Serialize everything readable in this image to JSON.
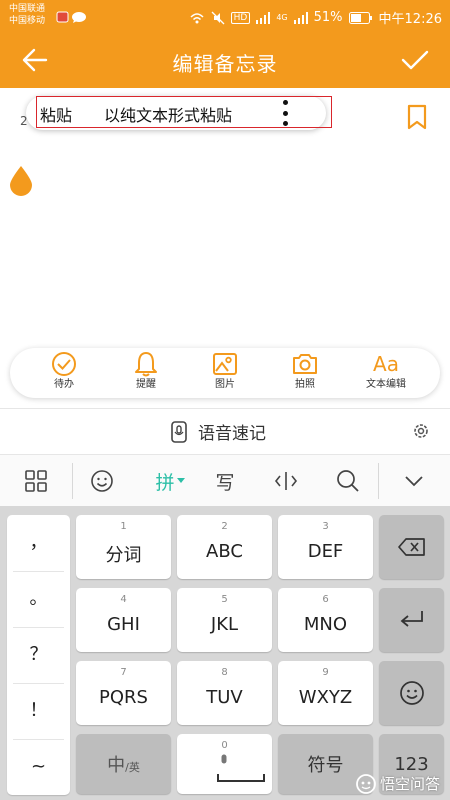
{
  "status_bar": {
    "carrier_1": "中国联通",
    "carrier_2": "中国移动",
    "hd_label": "HD",
    "net_label": "4G",
    "battery": "51%",
    "time": "中午12:26"
  },
  "header": {
    "title": "编辑备忘录"
  },
  "editor": {
    "caret_text": "2",
    "popup": {
      "paste_label": "粘贴",
      "paste_plain_label": "以纯文本形式粘贴"
    }
  },
  "note_toolbar": {
    "items": [
      {
        "label": "待办",
        "icon": "checkmark-circle-icon"
      },
      {
        "label": "提醒",
        "icon": "bell-icon"
      },
      {
        "label": "图片",
        "icon": "image-icon"
      },
      {
        "label": "拍照",
        "icon": "camera-icon"
      },
      {
        "label": "文本编辑",
        "icon": "text-format-icon",
        "glyph": "Aa"
      }
    ]
  },
  "voice": {
    "label": "语音速记"
  },
  "ime_toolbar": {
    "pinyin_label": "拼",
    "handwrite_label": "写"
  },
  "keyboard": {
    "punctuation": [
      "，",
      "。",
      "？",
      "！",
      "~"
    ],
    "keys": [
      {
        "num": "1",
        "label": "分词"
      },
      {
        "num": "2",
        "label": "ABC"
      },
      {
        "num": "3",
        "label": "DEF"
      },
      {
        "num": "4",
        "label": "GHI"
      },
      {
        "num": "5",
        "label": "JKL"
      },
      {
        "num": "6",
        "label": "MNO"
      },
      {
        "num": "7",
        "label": "PQRS"
      },
      {
        "num": "8",
        "label": "TUV"
      },
      {
        "num": "9",
        "label": "WXYZ"
      }
    ],
    "lang_main": "中",
    "lang_sub": "/英",
    "space_num": "0",
    "symbols_label": "符号",
    "numbers_label": "123"
  },
  "watermark": {
    "text": "悟空问答"
  },
  "colors": {
    "brand": "#f39a1d",
    "pinyin_accent": "#2cbfa7",
    "annotation_box": "#d9262c"
  }
}
